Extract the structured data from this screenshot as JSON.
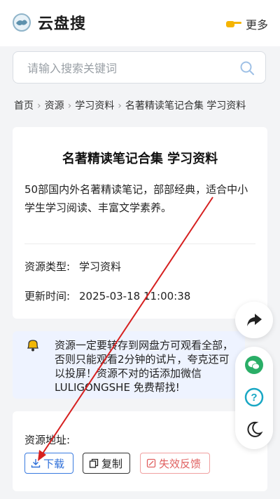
{
  "header": {
    "brand": "云盘搜",
    "more_label": "更多"
  },
  "search": {
    "placeholder": "请输入搜索关键词",
    "value": ""
  },
  "breadcrumb": [
    "首页",
    "资源",
    "学习资料",
    "名著精读笔记合集 学习资料"
  ],
  "resource": {
    "title": "名著精读笔记合集 学习资料",
    "description": "50部国内外名著精读笔记，部部经典，适合中小学生学习阅读、丰富文学素养。",
    "type_label": "资源类型:",
    "type_value": "学习资料",
    "updated_label": "更新时间:",
    "updated_value": "2025-03-18 11:00:38"
  },
  "notice": "资源一定要转存到网盘方可观看全部，否则只能观看2分钟的试片，夸克还可以投屏！资源不对的话添加微信 LULIGONGSHE 免费帮找!",
  "download": {
    "address_label": "资源地址:",
    "download_label": "下载",
    "copy_label": "复制",
    "report_label": "失效反馈"
  },
  "colors": {
    "accent": "#3a7be0",
    "warn": "#e06060",
    "arrow": "#d62020",
    "wechat": "#2aae67",
    "help": "#19a7c4"
  },
  "icons": [
    "logo-icon",
    "pointing-hand-icon",
    "search-icon",
    "bell-icon",
    "download-icon",
    "copy-icon",
    "report-icon",
    "share-icon",
    "wechat-icon",
    "help-icon",
    "moon-icon"
  ]
}
